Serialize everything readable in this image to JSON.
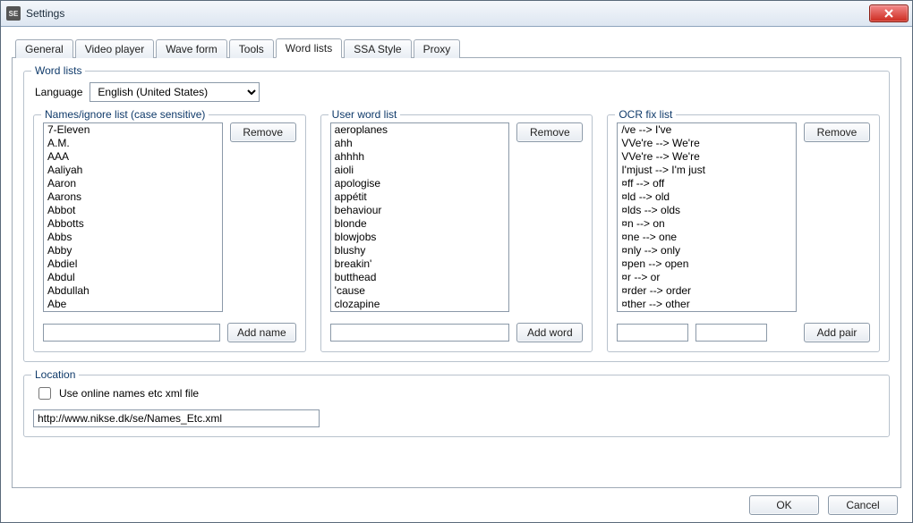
{
  "window": {
    "title": "Settings",
    "app_icon_text": "SE"
  },
  "tabs": [
    {
      "label": "General"
    },
    {
      "label": "Video player"
    },
    {
      "label": "Wave form"
    },
    {
      "label": "Tools"
    },
    {
      "label": "Word lists"
    },
    {
      "label": "SSA Style"
    },
    {
      "label": "Proxy"
    }
  ],
  "active_tab": "Word lists",
  "wordlists": {
    "group_label": "Word lists",
    "language_label": "Language",
    "language_value": "English (United States)",
    "names": {
      "group_label": "Names/ignore list (case sensitive)",
      "remove_label": "Remove",
      "add_label": "Add name",
      "add_value": "",
      "items": [
        "7-Eleven",
        "A.M.",
        "AAA",
        "Aaliyah",
        "Aaron",
        "Aarons",
        "Abbot",
        "Abbotts",
        "Abbs",
        "Abby",
        "Abdiel",
        "Abdul",
        "Abdullah",
        "Abe"
      ]
    },
    "user": {
      "group_label": "User word list",
      "remove_label": "Remove",
      "add_label": "Add word",
      "add_value": "",
      "items": [
        "aeroplanes",
        "ahh",
        "ahhhh",
        "aioli",
        "apologise",
        "appétit",
        "behaviour",
        "blonde",
        "blowjobs",
        "blushy",
        "breakin'",
        "butthead",
        "'cause",
        "clozapine"
      ]
    },
    "ocr": {
      "group_label": "OCR fix list",
      "remove_label": "Remove",
      "add_label": "Add pair",
      "add_left_value": "",
      "add_right_value": "",
      "items": [
        "/ve --> I've",
        "VVe're --> We're",
        "VVe're --> We're",
        "I'mjust --> I'm just",
        "¤ff --> off",
        "¤ld --> old",
        "¤lds --> olds",
        "¤n --> on",
        "¤ne --> one",
        "¤nly --> only",
        "¤pen --> open",
        "¤r --> or",
        "¤rder --> order",
        "¤ther --> other"
      ]
    }
  },
  "location": {
    "group_label": "Location",
    "checkbox_label": "Use online names etc xml file",
    "checkbox_checked": false,
    "url_value": "http://www.nikse.dk/se/Names_Etc.xml"
  },
  "buttons": {
    "ok": "OK",
    "cancel": "Cancel"
  }
}
